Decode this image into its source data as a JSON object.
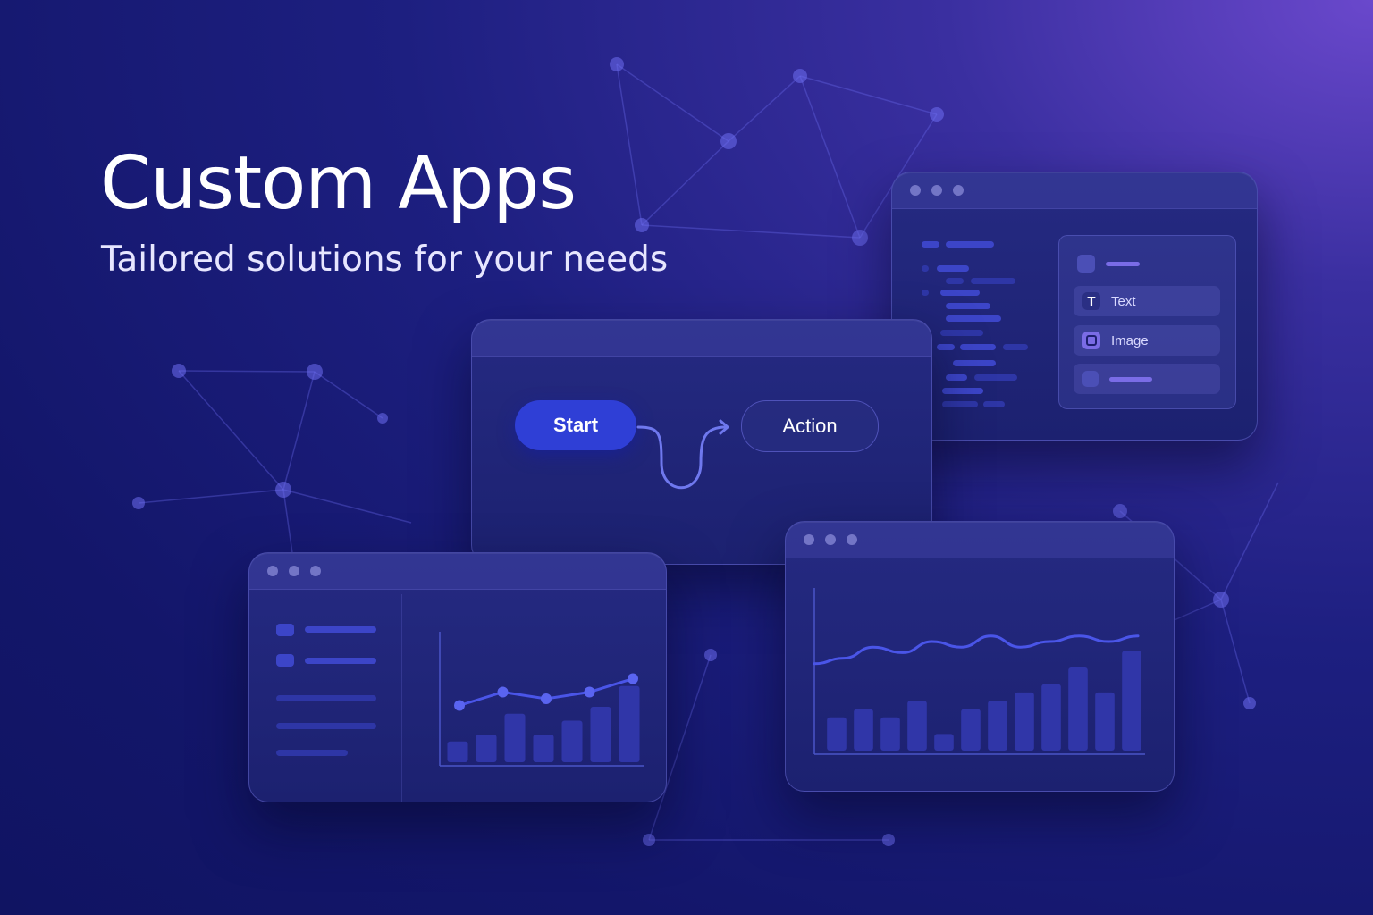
{
  "hero": {
    "title": "Custom Apps",
    "subtitle": "Tailored solutions for your needs"
  },
  "flow_window": {
    "start_label": "Start",
    "action_label": "Action"
  },
  "editor_window": {
    "panel_items": [
      {
        "icon": "text-icon",
        "glyph": "T",
        "label": "Text"
      },
      {
        "icon": "image-icon",
        "label": "Image"
      }
    ]
  },
  "colors": {
    "background_dark": "#13166a",
    "background_glow": "#6a48cc",
    "accent_blue": "#2f3fd6",
    "chart_bar": "#3036a8",
    "chart_line": "#4a55e8",
    "lavender": "#7a6ce6"
  },
  "chart_data": [
    {
      "type": "bar",
      "description_role": "dashboard mini chart (bars with overlay line)",
      "values": [
        3,
        4,
        7,
        4,
        6,
        8,
        11
      ],
      "line": [
        5,
        7,
        6,
        7,
        9
      ]
    },
    {
      "type": "bar",
      "description_role": "analytics chart (bars with overlay line)",
      "values": [
        4,
        5,
        4,
        6,
        2,
        5,
        6,
        7,
        8,
        10,
        7,
        12
      ],
      "line": [
        6,
        7,
        9,
        8,
        10,
        9,
        11,
        9,
        10,
        11,
        10,
        11
      ]
    }
  ]
}
